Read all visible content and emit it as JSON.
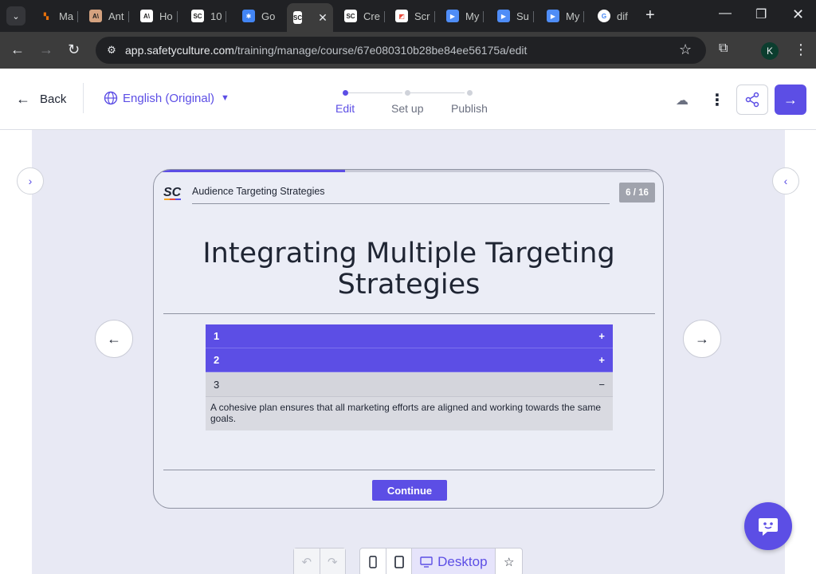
{
  "browser": {
    "tabs": [
      {
        "label": "Ma",
        "favicon_color": "#e8710a",
        "glyph": "▚"
      },
      {
        "label": "Ant",
        "favicon_color": "#d4a27f",
        "glyph": "A\\"
      },
      {
        "label": "Ho",
        "favicon_color": "#ffffff",
        "glyph": "A\\"
      },
      {
        "label": "10",
        "favicon_color": "#ffffff",
        "glyph": "SC"
      },
      {
        "label": "Go",
        "favicon_color": "#4285f4",
        "glyph": "✱"
      },
      {
        "label": "",
        "favicon_color": "#ffffff",
        "glyph": "SC"
      },
      {
        "label": "Cre",
        "favicon_color": "#ffffff",
        "glyph": "SC"
      },
      {
        "label": "Scr",
        "favicon_color": "#ffffff",
        "glyph": "◩"
      },
      {
        "label": "My",
        "favicon_color": "#4f8df7",
        "glyph": "▶"
      },
      {
        "label": "Su",
        "favicon_color": "#4f8df7",
        "glyph": "▶"
      },
      {
        "label": "My",
        "favicon_color": "#4f8df7",
        "glyph": "▶"
      },
      {
        "label": "dif",
        "favicon_color": "#ffffff",
        "glyph": "G"
      }
    ],
    "active_tab_close": "✕",
    "new_tab": "+",
    "url_host": "app.safetyculture.com",
    "url_path": "/training/manage/course/67e080310b28be84ee56175a/edit",
    "profile_initial": "K"
  },
  "appbar": {
    "back_label": "Back",
    "language": "English (Original)",
    "steps": [
      {
        "label": "Edit",
        "active": true
      },
      {
        "label": "Set up",
        "active": false
      },
      {
        "label": "Publish",
        "active": false
      }
    ]
  },
  "slide": {
    "progress_fraction": 0.375,
    "logo_text": "SC",
    "course_title": "Audience Targeting Strategies",
    "counter": "6 / 16",
    "heading": "Integrating Multiple Targeting Strategies",
    "accordion": [
      {
        "label": "1",
        "expanded": false,
        "icon": "+"
      },
      {
        "label": "2",
        "expanded": false,
        "icon": "+"
      },
      {
        "label": "3",
        "expanded": true,
        "icon": "−",
        "body": "A cohesive plan ensures that all marketing efforts are aligned and working towards the same goals."
      }
    ],
    "continue_label": "Continue"
  },
  "device_bar": {
    "desktop_label": "Desktop"
  },
  "colors": {
    "accent": "#5c4ee5",
    "workspace_bg": "#e8e9f4"
  }
}
